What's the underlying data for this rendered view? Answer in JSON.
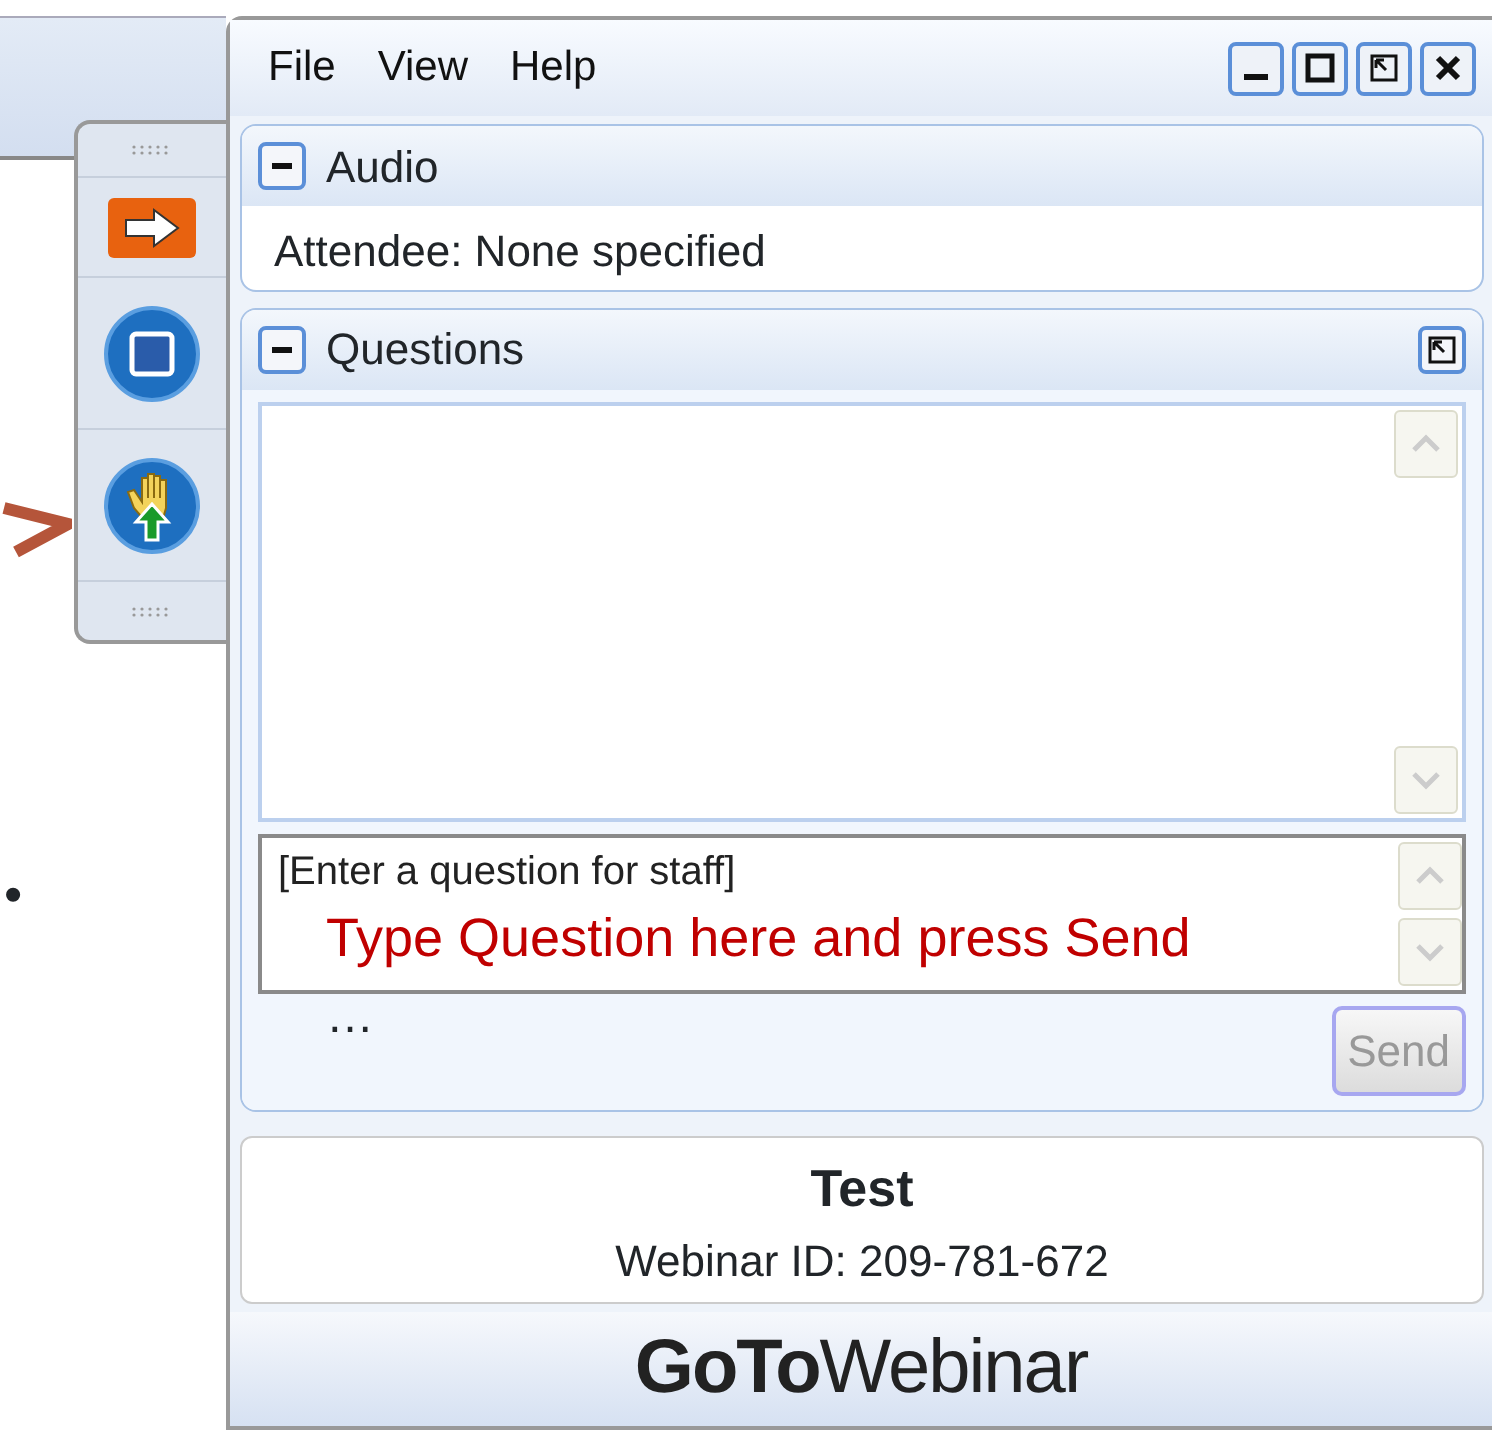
{
  "menu": [
    {
      "label": "File"
    },
    {
      "label": "View"
    },
    {
      "label": "Help"
    }
  ],
  "audio": {
    "title": "Audio",
    "expanded": true,
    "attendee": "Attendee: None specified"
  },
  "questions": {
    "title": "Questions",
    "expanded": true,
    "placeholder": "[Enter a question for staff]",
    "send": {
      "label": "Send",
      "disabled": true
    }
  },
  "annotation": {
    "text": "Type Question here and press Send",
    "ellipsis": "…",
    "bullet": "•"
  },
  "info": {
    "title": "Test",
    "webinar_id": "Webinar ID: 209-781-672"
  },
  "logo": "**GoTo**Webinar"
}
